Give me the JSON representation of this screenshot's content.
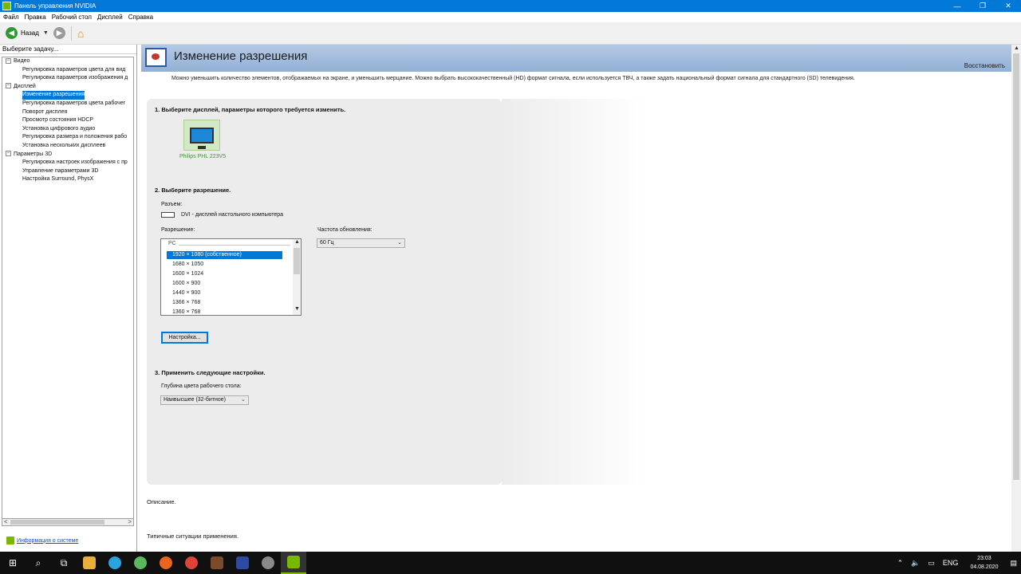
{
  "window": {
    "title": "Панель управления NVIDIA",
    "minimize": "—",
    "maximize": "❐",
    "close": "✕"
  },
  "menu": [
    "Файл",
    "Правка",
    "Рабочий стол",
    "Дисплей",
    "Справка"
  ],
  "toolbar": {
    "back_label": "Назад",
    "back_icon": "◀",
    "forward_icon": "▶",
    "dropdown_icon": "▼",
    "home_icon": "⌂"
  },
  "left_panel": {
    "header": "Выберите задачу...",
    "tree": [
      {
        "type": "root",
        "label": "Видео",
        "expander": "−"
      },
      {
        "type": "child",
        "label": "Регулировка параметров цвета для вид"
      },
      {
        "type": "child",
        "label": "Регулировка параметров изображения д"
      },
      {
        "type": "root",
        "label": "Дисплей",
        "expander": "−"
      },
      {
        "type": "child",
        "label": "Изменение разрешения",
        "selected": true
      },
      {
        "type": "child",
        "label": "Регулировка параметров цвета рабочег"
      },
      {
        "type": "child",
        "label": "Поворот дисплея"
      },
      {
        "type": "child",
        "label": "Просмотр состояния HDCP"
      },
      {
        "type": "child",
        "label": "Установка цифрового аудио"
      },
      {
        "type": "child",
        "label": "Регулировка размера и положения рабо"
      },
      {
        "type": "child",
        "label": "Установка нескольких дисплеев"
      },
      {
        "type": "root",
        "label": "Параметры 3D",
        "expander": "−"
      },
      {
        "type": "child",
        "label": "Регулировка настроек изображения с пр"
      },
      {
        "type": "child",
        "label": "Управление параметрами 3D"
      },
      {
        "type": "child",
        "label": "Настройка Surround, PhysX"
      }
    ],
    "scroll_left": "<",
    "scroll_right": ">",
    "system_info": "Информация о системе"
  },
  "main": {
    "heading": "Изменение разрешения",
    "restore": "Восстановить",
    "description": "Можно уменьшить количество элементов, отображаемых на экране, и уменьшить мерцание. Можно выбрать высококачественный (HD) формат сигнала, если используется ТВЧ, а также задать национальный формат сигнала для стандартного (SD) телевидения.",
    "step1": "1. Выберите дисплей, параметры которого требуется изменить.",
    "display_name": "Philips PHL 223V5",
    "step2": "2. Выберите разрешение.",
    "connector_label": "Разъем:",
    "connector_value": "DVI - дисплей настольного компьютера",
    "resolution_label": "Разрешение:",
    "resolution_group": "PC",
    "resolutions": [
      "1920 × 1080 (собственное)",
      "1680 × 1050",
      "1600 × 1024",
      "1600 × 900",
      "1440 × 900",
      "1366 × 768",
      "1360 × 768"
    ],
    "refresh_label": "Частота обновления:",
    "refresh_value": "60 Гц",
    "customize_button": "Настройка...",
    "step3": "3. Применить следующие настройки.",
    "color_depth_label": "Глубина цвета рабочего стола:",
    "color_depth_value": "Наивысшее (32-битное)",
    "description_label": "Описание.",
    "typical_label": "Типичные ситуации применения."
  },
  "taskbar": {
    "language": "ENG",
    "time": "23:03",
    "date": "04.08.2020"
  },
  "colors": {
    "titlebar": "#0078d7",
    "accent": "#76b900",
    "selection": "#0078d7"
  }
}
